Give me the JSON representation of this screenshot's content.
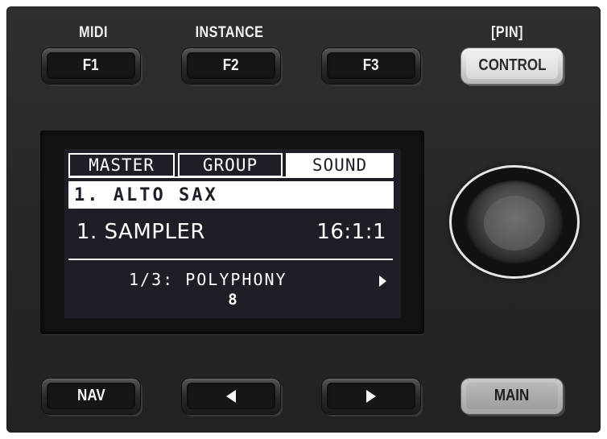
{
  "top_labels": {
    "f1": "MIDI",
    "f2": "INSTANCE",
    "control": "[PIN]"
  },
  "buttons": {
    "f1": "F1",
    "f2": "F2",
    "f3": "F3",
    "control": "CONTROL",
    "nav": "NAV",
    "main": "MAIN"
  },
  "icons": {
    "prev": "left-arrow-icon",
    "next": "right-arrow-icon",
    "param_next": "right-arrow-icon",
    "knob": "encoder-knob"
  },
  "display": {
    "tabs": [
      {
        "label": "MASTER",
        "active": false
      },
      {
        "label": "GROUP",
        "active": false
      },
      {
        "label": "SOUND",
        "active": true
      }
    ],
    "sound_name": "1. ALTO SAX",
    "plugin_name": "1. SAMPLER",
    "position": "16:1:1",
    "parameter": "1/3: POLYPHONY",
    "parameter_value": "8"
  },
  "colors": {
    "panel": "#2a2a2a",
    "screen": "#1d1e26",
    "lit_button": "#d9d9d9"
  }
}
